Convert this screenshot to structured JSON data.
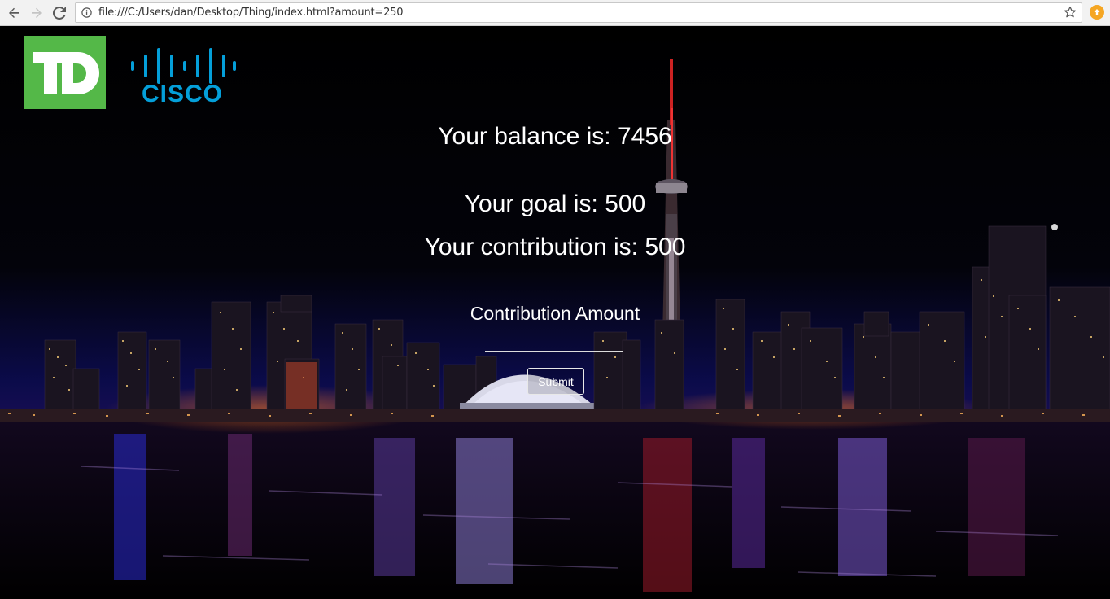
{
  "browser": {
    "url": "file:///C:/Users/dan/Desktop/Thing/index.html?amount=250",
    "back_icon": "back-arrow-icon",
    "forward_icon": "forward-arrow-icon",
    "reload_icon": "reload-icon",
    "info_icon": "info-icon",
    "bookmark_icon": "star-icon",
    "extension_icon": "extension-icon"
  },
  "header": {
    "td_logo": "TD",
    "cisco_logo": "CISCO"
  },
  "main": {
    "balance_text": "Your balance is: 7456",
    "goal_text": "Your goal is: 500",
    "contribution_text": "Your contribution is: 500",
    "form_label": "Contribution Amount",
    "amount_value": "",
    "submit_label": "Submit"
  },
  "colors": {
    "td_green": "#54b848",
    "cisco_blue": "#049fd9",
    "text": "#ffffff"
  }
}
